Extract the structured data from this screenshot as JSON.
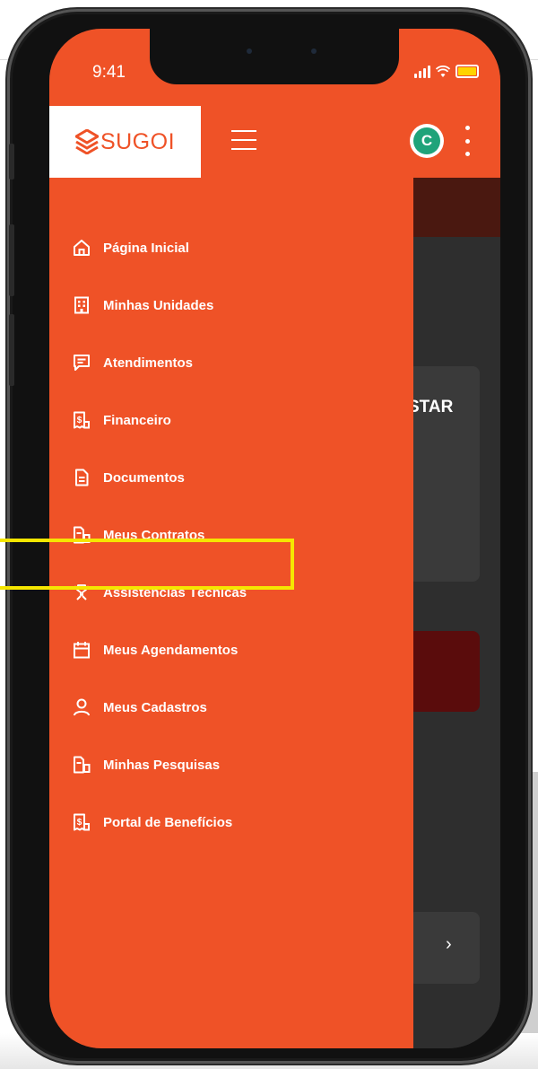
{
  "status": {
    "time": "9:41"
  },
  "app": {
    "brand": "SUGOI",
    "avatar_letter": "C"
  },
  "background": {
    "partial_text": "STAR",
    "chevron": "›"
  },
  "menu": [
    {
      "label": "Página Inicial",
      "icon": "home-icon"
    },
    {
      "label": "Minhas Unidades",
      "icon": "building-icon"
    },
    {
      "label": "Atendimentos",
      "icon": "chat-icon"
    },
    {
      "label": "Financeiro",
      "icon": "receipt-icon"
    },
    {
      "label": "Documentos",
      "icon": "document-icon"
    },
    {
      "label": "Meus Contratos",
      "icon": "contract-icon"
    },
    {
      "label": "Assistências Técnicas",
      "icon": "tools-icon"
    },
    {
      "label": "Meus Agendamentos",
      "icon": "calendar-icon"
    },
    {
      "label": "Meus Cadastros",
      "icon": "user-icon"
    },
    {
      "label": "Minhas Pesquisas",
      "icon": "survey-icon"
    },
    {
      "label": "Portal de Benefícios",
      "icon": "benefits-icon"
    }
  ],
  "colors": {
    "brand": "#ef5227",
    "highlight": "#f5e600",
    "avatar": "#1fa37a"
  }
}
